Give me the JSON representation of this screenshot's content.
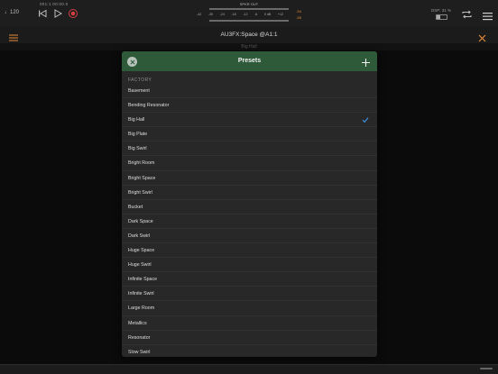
{
  "transport": {
    "tempo": "♩120",
    "position": "001:1  00:00.0",
    "icons": [
      "rewind-icon",
      "play-icon",
      "record-icon"
    ],
    "meter": {
      "title": "SPKR OUT",
      "scale": [
        "-42",
        "-30",
        "-24",
        "-18",
        "-12",
        "-6",
        "0 dB",
        "+12"
      ],
      "left_peak": "-54",
      "right_peak": "-55"
    },
    "dsp": "DSP: 31 %",
    "battery_level": 0.35,
    "accent_color": "#e08a3a"
  },
  "plugin_bar": {
    "title": "AU3FX:Space @A1:1",
    "current_preset": "Big Hall"
  },
  "modal": {
    "title": "Presets",
    "section": "FACTORY",
    "header_color": "#2e5a3a",
    "check_color": "#3d8fe0",
    "items": [
      {
        "label": "Basement"
      },
      {
        "label": "Bending Resonator"
      },
      {
        "label": "Big Hall",
        "selected": true
      },
      {
        "label": "Big Plate"
      },
      {
        "label": "Big Swirl"
      },
      {
        "label": "Bright Room"
      },
      {
        "label": "Bright Space"
      },
      {
        "label": "Bright Swirl"
      },
      {
        "label": "Bucket"
      },
      {
        "label": "Dark Space"
      },
      {
        "label": "Dark Swirl"
      },
      {
        "label": "Huge Space"
      },
      {
        "label": "Huge Swirl"
      },
      {
        "label": "Infinite Space"
      },
      {
        "label": "Infinite Swirl"
      },
      {
        "label": "Large Room"
      },
      {
        "label": "Metallics"
      },
      {
        "label": "Resonator"
      },
      {
        "label": "Slow Swirl"
      }
    ]
  }
}
